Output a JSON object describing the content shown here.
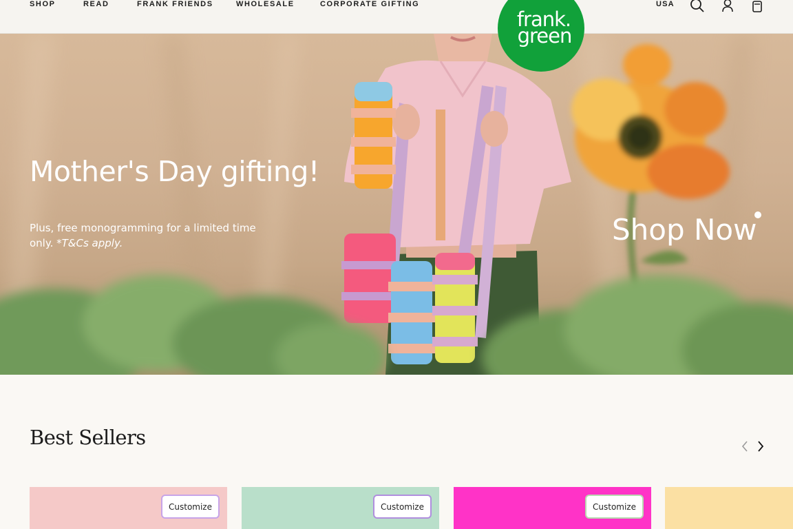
{
  "nav": {
    "items": [
      {
        "label": "SHOP"
      },
      {
        "label": "READ"
      },
      {
        "label": "FRANK FRIENDS"
      },
      {
        "label": "WHOLESALE"
      },
      {
        "label": "CORPORATE GIFTING"
      }
    ],
    "region": "USA",
    "icons": [
      "search-icon",
      "account-icon",
      "bag-icon"
    ]
  },
  "logo": {
    "line1": "frank.",
    "line2": "green",
    "color": "#11a13a"
  },
  "hero": {
    "title": "Mother's Day gifting!",
    "subtitle_plain": "Plus, free monogramming for a limited time only. ",
    "subtitle_italic": "*T&Cs apply.",
    "cta": "Shop Now"
  },
  "best_sellers": {
    "title": "Best Sellers",
    "cards": [
      {
        "button": "Customize",
        "bg": "#f5c9c8",
        "border": "#c7a4e8"
      },
      {
        "button": "Customize",
        "bg": "#b9dfca",
        "border": "#b08ede"
      },
      {
        "button": "Customize",
        "bg": "#ff33c7",
        "border": "#b8d9b0"
      },
      {
        "bg": "#fbe0a3"
      }
    ]
  }
}
